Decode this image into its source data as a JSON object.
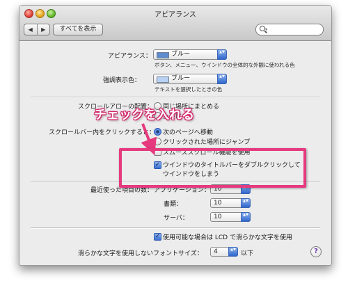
{
  "window": {
    "title": "アピアランス"
  },
  "toolbar": {
    "back_glyph": "◀",
    "forward_glyph": "▶",
    "show_all_label": "すべてを表示",
    "search_placeholder": ""
  },
  "appearance": {
    "label": "アピアランス：",
    "value": "ブルー",
    "swatch_color": "#5f8ccc",
    "description": "ボタン、メニュー、ウインドウの全体的な外観に使われる色"
  },
  "highlight": {
    "label": "強調表示色：",
    "value": "ブルー",
    "swatch_color": "#b9d2f4",
    "description": "テキストを選択したときの色"
  },
  "scroll_arrows": {
    "label": "スクロールアローの配置：",
    "options": [
      "同じ場所にまとめる",
      "上下に"
    ]
  },
  "scrollbar_click": {
    "label": "スクロールバー内をクリックすると：",
    "options": [
      "次のページへ移動",
      "クリックされた場所にジャンプ"
    ],
    "selected_index": 0
  },
  "checkboxes": {
    "smooth_scroll": {
      "label": "スムーズスクロール機能を使用",
      "checked": false
    },
    "double_click_minimize": {
      "line1": "ウインドウのタイトルバーをダブルクリックして",
      "line2": "ウインドウをしまう",
      "checked": true
    }
  },
  "recent_items": {
    "label": "最近使った項目の数：",
    "rows": [
      {
        "label": "アプリケーション：",
        "value": "10"
      },
      {
        "label": "書類：",
        "value": "10"
      },
      {
        "label": "サーバ：",
        "value": "10"
      }
    ]
  },
  "font_smoothing": {
    "checkbox_label": "使用可能な場合は LCD で滑らかな文字を使用",
    "checked": true,
    "min_size_label": "滑らかな文字を使用しないフォントサイズ：",
    "min_size_value": "4",
    "min_size_suffix": "以下"
  },
  "help_glyph": "?",
  "annotation": {
    "text": "チェックを入れる",
    "color": "#e63a7e"
  },
  "popup_arrow_glyph": "▲▼",
  "check_glyph": "✓"
}
